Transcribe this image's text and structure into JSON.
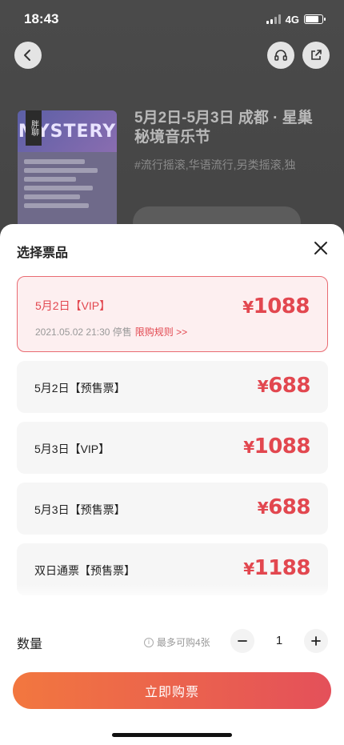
{
  "status_bar": {
    "time": "18:43",
    "network": "4G"
  },
  "background": {
    "poster": {
      "top_text": "MYSTERY",
      "tag": "胖聊"
    },
    "event_title": "5月2日-5月3日 成都 · 星巢秘境音乐节",
    "event_tags": "#流行摇滚,华语流行,另类摇滚,独"
  },
  "sheet": {
    "title": "选择票品",
    "tickets": [
      {
        "name": "5月2日【VIP】",
        "price_symbol": "¥",
        "price": "1088",
        "selected": true,
        "note": "2021.05.02 21:30 停售",
        "rule": "限购规则 >>"
      },
      {
        "name": "5月2日【预售票】",
        "price_symbol": "¥",
        "price": "688"
      },
      {
        "name": "5月3日【VIP】",
        "price_symbol": "¥",
        "price": "1088"
      },
      {
        "name": "5月3日【预售票】",
        "price_symbol": "¥",
        "price": "688"
      },
      {
        "name": "双日通票【预售票】",
        "price_symbol": "¥",
        "price": "1188"
      }
    ],
    "quantity": {
      "label": "数量",
      "limit": "最多可购4张",
      "value": "1"
    },
    "buy_label": "立即购票"
  },
  "colors": {
    "accent": "#e2474f",
    "button_start": "#f2773f",
    "button_end": "#e4505a"
  }
}
